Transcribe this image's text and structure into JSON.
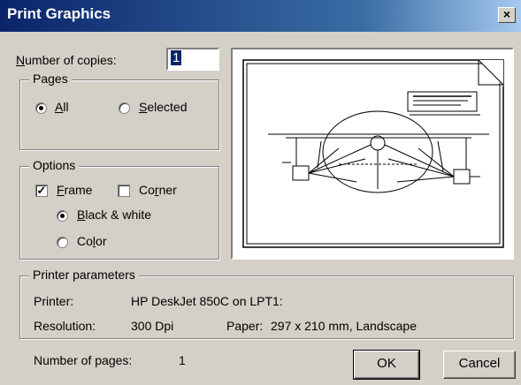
{
  "window": {
    "title": "Print Graphics",
    "close_glyph": "×"
  },
  "copies": {
    "label_accel": "N",
    "label_rest": "umber of copies:",
    "value": "1"
  },
  "pages": {
    "title": "Pages",
    "all_accel": "A",
    "all_rest": "ll",
    "selected_accel": "S",
    "selected_rest": "elected",
    "selected_option": "All"
  },
  "options": {
    "title": "Options",
    "frame_accel": "F",
    "frame_rest": "rame",
    "frame_checked": true,
    "corner_pre": "Co",
    "corner_accel": "r",
    "corner_rest": "ner",
    "corner_checked": false,
    "bw_accel": "B",
    "bw_rest": "lack & white",
    "color_pre": "Co",
    "color_accel": "l",
    "color_rest": "or",
    "color_mode": "Black & white",
    "check_glyph": "✓"
  },
  "printer": {
    "title": "Printer parameters",
    "printer_label": "Printer:",
    "printer_value": "HP DeskJet 850C on LPT1:",
    "resolution_label": "Resolution:",
    "resolution_value": "300 Dpi",
    "paper_label": "Paper:",
    "paper_value": "297 x 210 mm, Landscape"
  },
  "footer": {
    "pages_label": "Number of pages:",
    "pages_value": "1"
  },
  "buttons": {
    "ok": "OK",
    "cancel": "Cancel"
  },
  "colors": {
    "titlebar": "#0a246a",
    "face": "#d4d0c8",
    "selection": "#0a246a"
  },
  "icons": [
    "close-icon",
    "page-fold-icon"
  ]
}
